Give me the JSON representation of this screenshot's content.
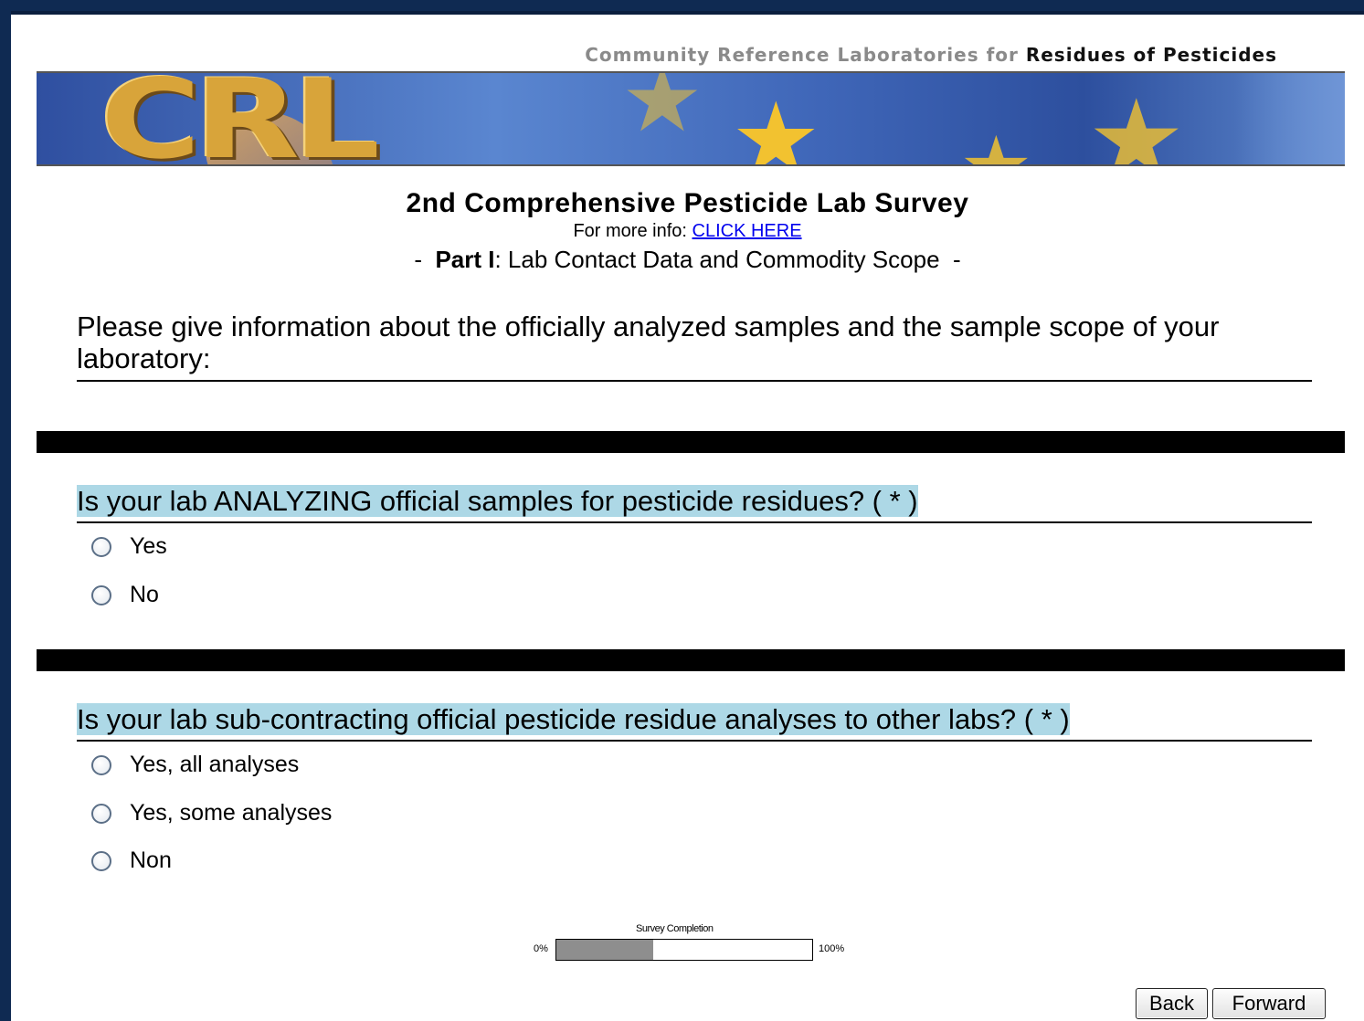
{
  "header": {
    "org_prefix": "Community Reference Laboratories for",
    "org_strong": "Residues of Pesticides",
    "logo_text": "CRL"
  },
  "survey": {
    "title": "2nd Comprehensive Pesticide Lab Survey",
    "more_info_prefix": "For more info:",
    "more_info_link": "CLICK HERE",
    "part_dash_left": "-",
    "part_label": "Part I",
    "part_desc": ": Lab Contact Data and Commodity Scope",
    "part_dash_right": "-"
  },
  "intro": "Please give information about the officially analyzed samples and the sample scope of your laboratory:",
  "questions": [
    {
      "text": "Is your lab ANALYZING official samples for pesticide residues? ( * )",
      "options": [
        "Yes",
        "No"
      ]
    },
    {
      "text": "Is your lab sub-contracting official pesticide residue analyses to other labs? ( * )",
      "options": [
        "Yes, all analyses",
        "Yes, some analyses",
        "Non"
      ]
    }
  ],
  "progress": {
    "label": "Survey Completion",
    "min_label": "0%",
    "max_label": "100%",
    "fraction": 0.38
  },
  "nav": {
    "back": "Back",
    "forward": "Forward"
  },
  "colors": {
    "page_frame": "#0f2a52",
    "question_highlight": "#add8e6",
    "link": "#0000ee",
    "progress_fill": "#8e8e8e"
  }
}
